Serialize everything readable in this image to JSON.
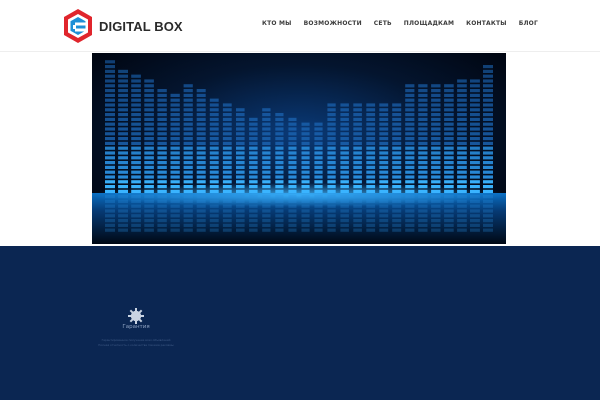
{
  "brand": {
    "name": "DIGITAL BOX",
    "logo_colors": {
      "outer": "#e0252c",
      "inner": "#1e8fd6"
    }
  },
  "nav": {
    "items": [
      "КТО МЫ",
      "ВОЗМОЖНОСТИ",
      "СЕТЬ",
      "ПЛОЩАДКАМ",
      "КОНТАКТЫ",
      "БЛОГ"
    ]
  },
  "hero": {
    "image": "audio-equalizer-banner"
  },
  "footer": {
    "background": "#0b2652",
    "feature": {
      "icon": "gear-badge-icon",
      "title": "Гарантия",
      "desc_line1": "Гарантированное получение всех объявлений",
      "desc_line2": "Полная отчетность о количестве показов рекламы"
    }
  }
}
